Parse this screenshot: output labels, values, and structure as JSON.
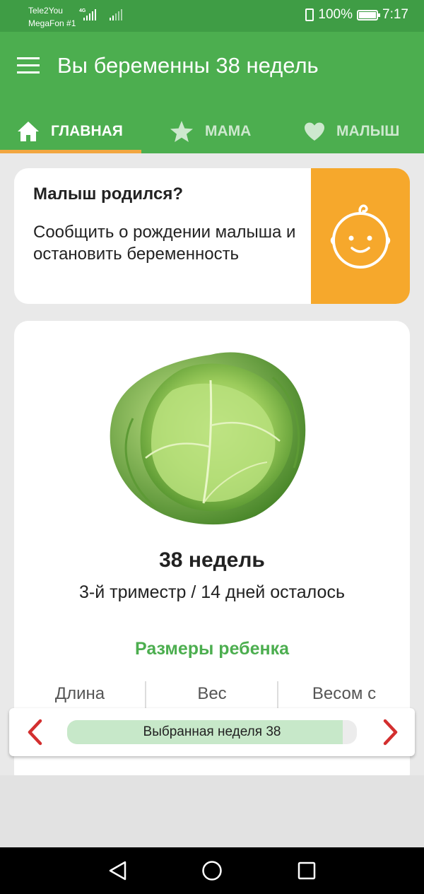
{
  "status_bar": {
    "carrier_1": "Tele2You",
    "carrier_2": "MegaFon #1",
    "network_type": "4G",
    "battery": "100%",
    "time": "7:17",
    "icons": [
      "signal-icon",
      "vibrate-icon",
      "battery-icon"
    ]
  },
  "app_bar": {
    "title": "Вы беременны 38 недель",
    "menu_icon": "hamburger-menu-icon"
  },
  "tabs": [
    {
      "label": "ГЛАВНАЯ",
      "icon": "home-icon",
      "selected": true
    },
    {
      "label": "МАМА",
      "icon": "star-icon",
      "selected": false
    },
    {
      "label": "МАЛЫШ",
      "icon": "heart-icon",
      "selected": false
    }
  ],
  "born_card": {
    "title": "Малыш родился?",
    "description": "Сообщить о рождении малыша и остановить беременность",
    "icon": "baby-face-icon"
  },
  "week_card": {
    "image": "cabbage-image",
    "week_title": "38 недель",
    "subtitle": "3-й триместр / 14 дней осталось",
    "sizes_link": "Размеры ребенка",
    "columns": [
      "Длина",
      "Вес",
      "Весом с"
    ]
  },
  "week_picker": {
    "label": "Выбранная неделя 38",
    "progress": 0.95,
    "prev_icon": "chevron-left-icon",
    "next_icon": "chevron-right-icon"
  },
  "nav_bar": {
    "icons": [
      "back-icon",
      "home-circle-icon",
      "recents-icon"
    ]
  },
  "colors": {
    "status_bar": "#3f9d45",
    "primary": "#4cae4f",
    "accent_orange": "#f6a82c",
    "tab_indicator": "#f2a640",
    "arrow_red": "#d32f2f",
    "picker_fill": "#c7e8c9"
  }
}
